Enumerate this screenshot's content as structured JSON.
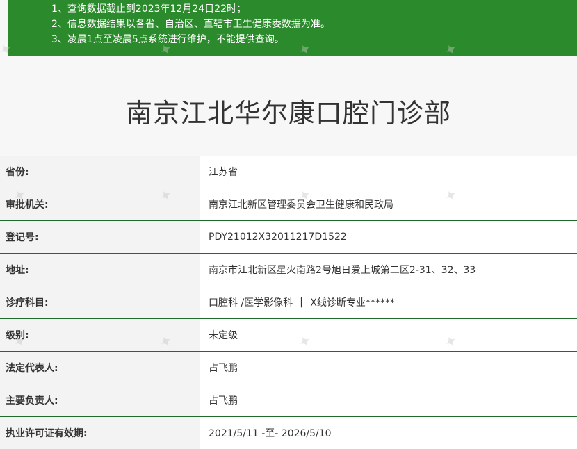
{
  "notice": [
    "1、查询数据截止到2023年12月24日22时；",
    "2、信息数据结果以各省、自治区、直辖市卫生健康委数据为准。",
    "3、凌晨1点至凌晨5点系统进行维护，不能提供查询。"
  ],
  "title": "南京江北华尔康口腔门诊部",
  "rows": [
    {
      "label": "省份:",
      "value": "江苏省"
    },
    {
      "label": "审批机关:",
      "value": "南京江北新区管理委员会卫生健康和民政局"
    },
    {
      "label": "登记号:",
      "value": "PDY21012X32011217D1522"
    },
    {
      "label": "地址:",
      "value": "南京市江北新区星火南路2号旭日爱上城第二区2-31、32、33"
    },
    {
      "label": "诊疗科目:",
      "value_a": "口腔科 /医学影像科",
      "pipe": "|",
      "value_b": "X线诊断专业******"
    },
    {
      "label": "级别:",
      "value": "未定级"
    },
    {
      "label": "法定代表人:",
      "value": "占飞鹏"
    },
    {
      "label": "主要负责人:",
      "value": "占飞鹏"
    },
    {
      "label": "执业许可证有效期:",
      "value": "2021/5/11 -至- 2026/5/10"
    }
  ]
}
